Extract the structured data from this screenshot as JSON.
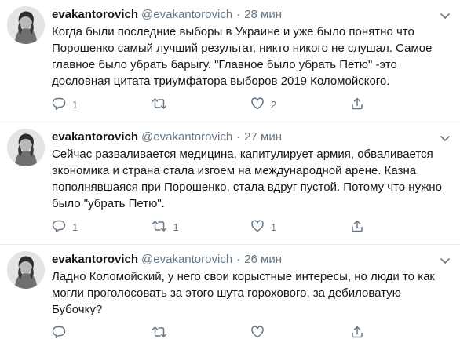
{
  "colors": {
    "text": "#14171a",
    "secondary": "#657786",
    "divider": "#e6ecf0"
  },
  "tweets": [
    {
      "name": "evakantorovich",
      "handle": "@evakantorovich",
      "separator": "·",
      "time": "28 мин",
      "text": "Когда были последние выборы в Украине и уже было понятно что Порошенко самый лучший результат, никто никого не слушал. Самое главное было убрать барыгу. \"Главное было убрать Петю\" -это дословная цитата триумфатора выборов 2019 Коломойского.",
      "reply_count": "1",
      "retweet_count": "",
      "like_count": "2",
      "icons": [
        "reply-icon",
        "retweet-icon",
        "like-icon",
        "share-icon"
      ]
    },
    {
      "name": "evakantorovich",
      "handle": "@evakantorovich",
      "separator": "·",
      "time": "27 мин",
      "text": "Сейчас разваливается медицина, капитулирует армия, обваливается экономика и страна стала изгоем на международной арене.  Казна пополнявшаяся при Порошенко, стала вдруг пустой. Потому что нужно было \"убрать Петю\".",
      "reply_count": "1",
      "retweet_count": "1",
      "like_count": "1",
      "icons": [
        "reply-icon",
        "retweet-icon",
        "like-icon",
        "share-icon"
      ]
    },
    {
      "name": "evakantorovich",
      "handle": "@evakantorovich",
      "separator": "·",
      "time": "26 мин",
      "text": "Ладно Коломойский, у него свои корыстные интересы, но люди то как могли проголосовать за этого шута горохового, за дебиловатую Бубочку?",
      "reply_count": "",
      "retweet_count": "",
      "like_count": "",
      "icons": [
        "reply-icon",
        "retweet-icon",
        "like-icon",
        "share-icon"
      ]
    }
  ]
}
